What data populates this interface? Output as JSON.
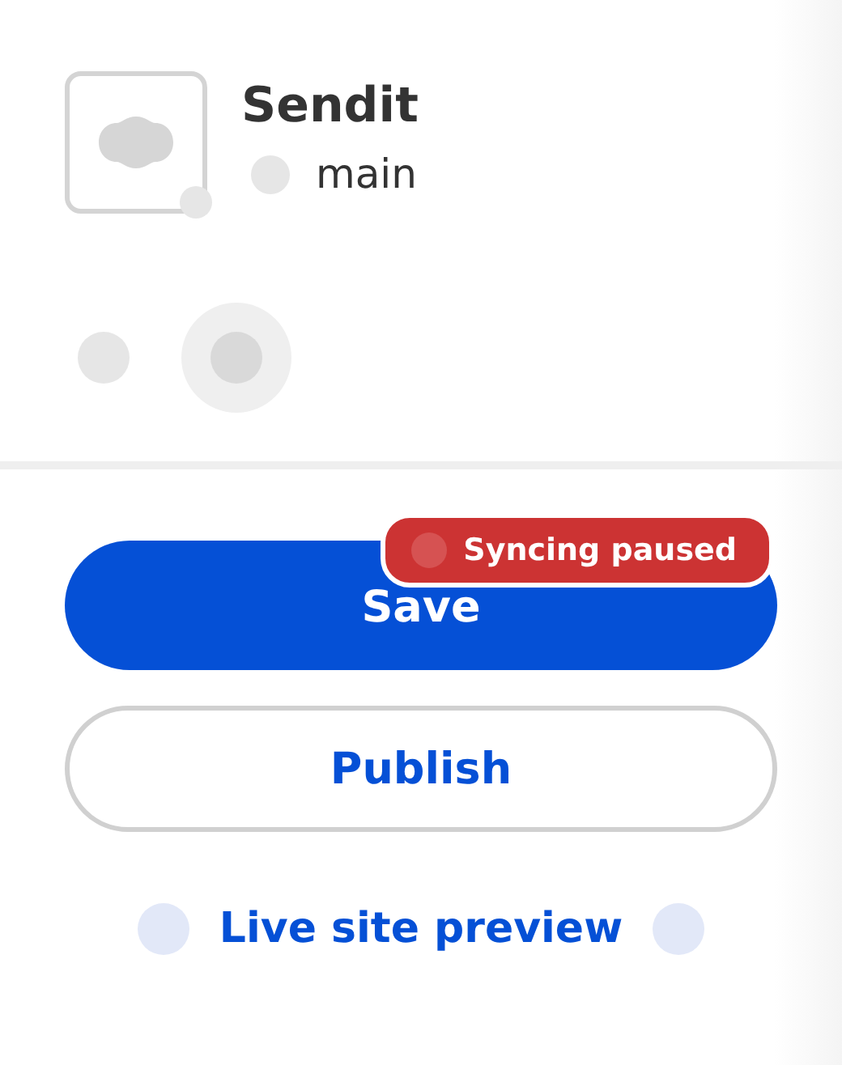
{
  "site": {
    "name": "Sendit",
    "branch": "main"
  },
  "sync_badge": {
    "label": "Syncing paused"
  },
  "save_button": {
    "label": "Save"
  },
  "publish_button": {
    "label": "Publish"
  },
  "preview_link": {
    "label": "Live site preview"
  }
}
